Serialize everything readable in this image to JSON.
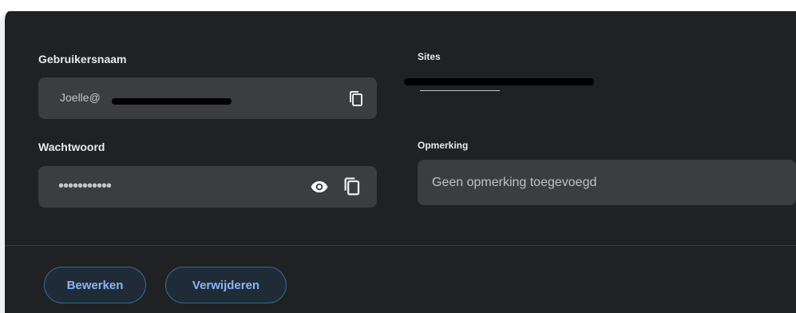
{
  "username": {
    "label": "Gebruikersnaam",
    "value": "Joelle@",
    "copy_icon": "copy-icon"
  },
  "password": {
    "label": "Wachtwoord",
    "masked_value": "•••••••••••",
    "show_icon": "eye-icon",
    "copy_icon": "copy-icon"
  },
  "sites": {
    "label": "Sites",
    "value": ""
  },
  "note": {
    "label": "Opmerking",
    "value": "Geen opmerking toegevoegd"
  },
  "actions": {
    "edit_label": "Bewerken",
    "delete_label": "Verwijderen"
  },
  "colors": {
    "background": "#202124",
    "field": "#3c3d40",
    "accent": "#8ab4f8",
    "button_border": "#2f6d8e"
  }
}
